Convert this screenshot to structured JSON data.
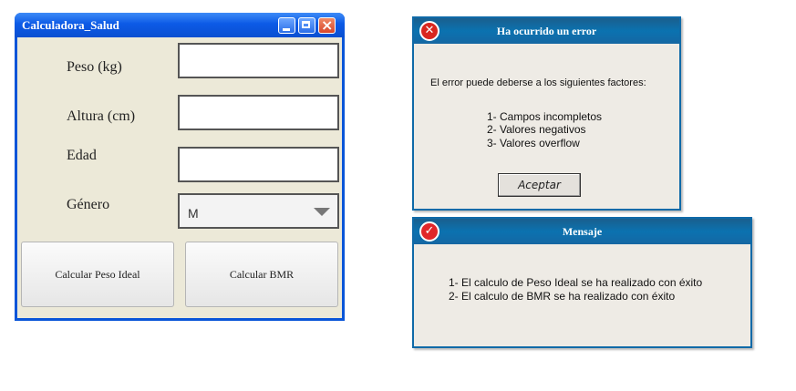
{
  "main_window": {
    "title": "Calculadora_Salud",
    "labels": {
      "peso": "Peso (kg)",
      "altura": "Altura (cm)",
      "edad": "Edad",
      "genero": "Género"
    },
    "inputs": {
      "peso": "",
      "altura": "",
      "edad": ""
    },
    "genero_select": {
      "selected": "M"
    },
    "buttons": {
      "peso_ideal": "Calcular Peso Ideal",
      "bmr": "Calcular BMR"
    },
    "colors": {
      "titlebar": "#0c5ae6",
      "body": "#ece9d8"
    }
  },
  "error_dialog": {
    "title": "Ha ocurrido un error",
    "icon": "error-x-icon",
    "message": "El error puede deberse a los siguientes factores:",
    "factors": [
      "1- Campos incompletos",
      "2- Valores negativos",
      "3- Valores overflow"
    ],
    "accept_label": "Aceptar"
  },
  "message_dialog": {
    "title": "Mensaje",
    "icon": "check-icon",
    "lines": [
      "1- El calculo de Peso Ideal se ha realizado con éxito",
      "2- El calculo de BMR se ha realizado con éxito"
    ]
  }
}
